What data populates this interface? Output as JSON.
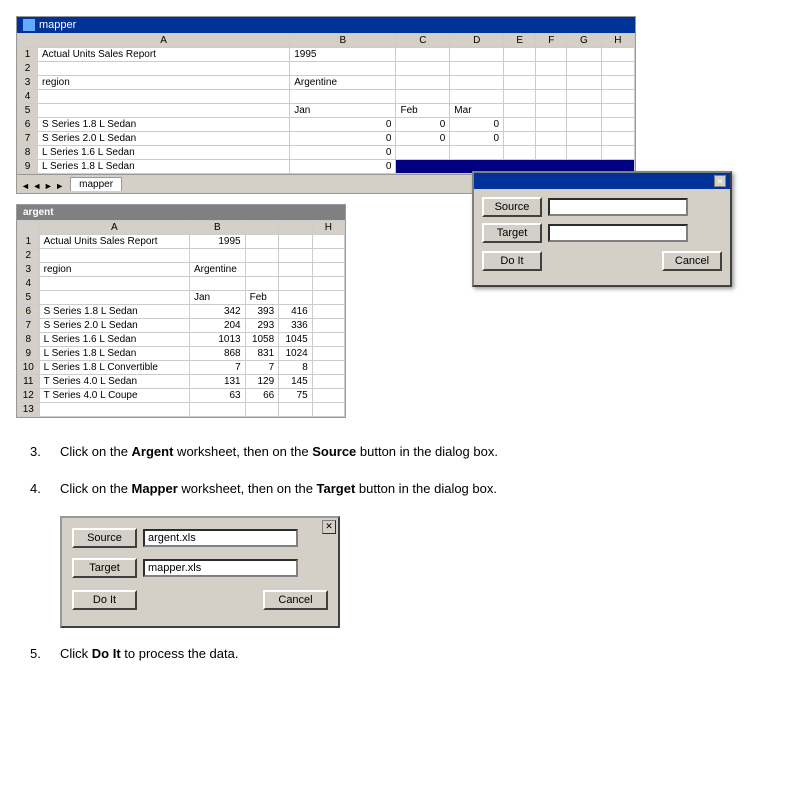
{
  "title": "mapper",
  "spreadsheet_top": {
    "title": "mapper",
    "columns": [
      "",
      "A",
      "B",
      "C",
      "D",
      "E",
      "F",
      "G",
      "H"
    ],
    "rows": [
      {
        "num": "1",
        "cells": [
          "Actual Units Sales Report",
          "1995",
          "",
          "",
          "",
          "",
          "",
          ""
        ]
      },
      {
        "num": "2",
        "cells": [
          "",
          "",
          "",
          "",
          "",
          "",
          "",
          ""
        ]
      },
      {
        "num": "3",
        "cells": [
          "region",
          "Argentine",
          "",
          "",
          "",
          "",
          "",
          ""
        ]
      },
      {
        "num": "4",
        "cells": [
          "",
          "",
          "",
          "",
          "",
          "",
          "",
          ""
        ]
      },
      {
        "num": "5",
        "cells": [
          "",
          "Jan",
          "Feb",
          "Mar",
          "",
          "",
          "",
          ""
        ]
      },
      {
        "num": "6",
        "cells": [
          "S Series 1.8 L Sedan",
          "0",
          "0",
          "0",
          "",
          "",
          "",
          ""
        ]
      },
      {
        "num": "7",
        "cells": [
          "S Series 2.0 L Sedan",
          "0",
          "0",
          "0",
          "",
          "",
          "",
          ""
        ]
      },
      {
        "num": "8",
        "cells": [
          "L Series 1.6 L Sedan",
          "0",
          "",
          "",
          "",
          "",
          "",
          ""
        ]
      },
      {
        "num": "9",
        "cells": [
          "L Series 1.8 L Sedan",
          "0",
          "",
          "",
          "",
          "",
          "",
          ""
        ]
      }
    ],
    "tab": "mapper"
  },
  "dialog_top": {
    "source_label": "Source",
    "target_label": "Target",
    "doit_label": "Do It",
    "cancel_label": "Cancel",
    "source_value": "",
    "target_value": ""
  },
  "spreadsheet_argent": {
    "title": "argent",
    "columns": [
      "",
      "A",
      "B",
      "H"
    ],
    "rows": [
      {
        "num": "1",
        "cells": [
          "Actual Units Sales Report",
          "1995",
          ""
        ]
      },
      {
        "num": "2",
        "cells": [
          "",
          "",
          ""
        ]
      },
      {
        "num": "3",
        "cells": [
          "region",
          "Argentine",
          ""
        ]
      },
      {
        "num": "4",
        "cells": [
          "",
          "",
          ""
        ]
      },
      {
        "num": "5",
        "cells": [
          "",
          "Jan",
          "Feb"
        ]
      },
      {
        "num": "6",
        "cells": [
          "S Series 1.8 L Sedan",
          "342",
          "393",
          "416"
        ]
      },
      {
        "num": "7",
        "cells": [
          "S Series 2.0 L Sedan",
          "204",
          "293",
          "336"
        ]
      },
      {
        "num": "8",
        "cells": [
          "L Series 1.6 L Sedan",
          "1013",
          "1058",
          "1045"
        ]
      },
      {
        "num": "9",
        "cells": [
          "L Series 1.8 L Sedan",
          "868",
          "831",
          "1024"
        ]
      },
      {
        "num": "10",
        "cells": [
          "L Series 1.8 L Convertible",
          "7",
          "7",
          "8"
        ]
      },
      {
        "num": "11",
        "cells": [
          "T Series 4.0 L Sedan",
          "131",
          "129",
          "145"
        ]
      },
      {
        "num": "12",
        "cells": [
          "T Series 4.0 L Coupe",
          "63",
          "66",
          "75"
        ]
      },
      {
        "num": "13",
        "cells": [
          "",
          "",
          ""
        ]
      }
    ]
  },
  "instructions": [
    {
      "num": "3.",
      "text_parts": [
        {
          "text": "Click on the ",
          "bold": false
        },
        {
          "text": "Argent",
          "bold": true
        },
        {
          "text": " worksheet, then on the ",
          "bold": false
        },
        {
          "text": "Source",
          "bold": true
        },
        {
          "text": " button in the dialog box.",
          "bold": false
        }
      ]
    },
    {
      "num": "4.",
      "text_parts": [
        {
          "text": "Click on the ",
          "bold": false
        },
        {
          "text": "Mapper",
          "bold": true
        },
        {
          "text": " worksheet, then on the ",
          "bold": false
        },
        {
          "text": "Target",
          "bold": true
        },
        {
          "text": " button in the dialog box.",
          "bold": false
        }
      ]
    },
    {
      "num": "5.",
      "text_parts": [
        {
          "text": "Click ",
          "bold": false
        },
        {
          "text": "Do It",
          "bold": true
        },
        {
          "text": " to process the data.",
          "bold": false
        }
      ]
    }
  ],
  "dialog_bottom": {
    "source_label": "Source",
    "target_label": "Target",
    "doit_label": "Do It",
    "cancel_label": "Cancel",
    "source_value": "argent.xls",
    "target_value": "mapper.xls"
  }
}
